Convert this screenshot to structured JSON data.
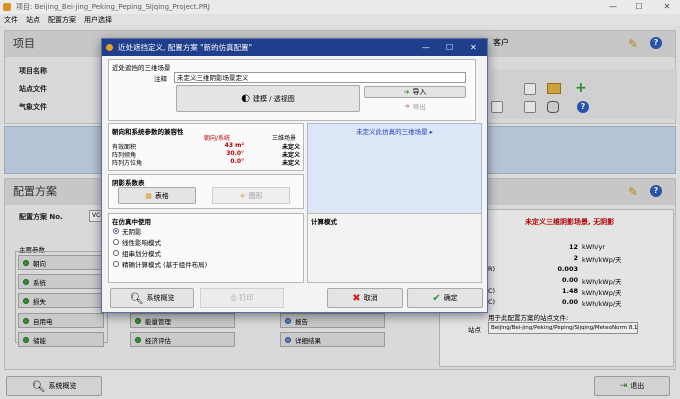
{
  "window": {
    "title": "项目: Beijing_Bei-jing_Peking_Peping_Sijqing_Project.PRJ"
  },
  "menu": [
    "文件",
    "站点",
    "配置方案",
    "用户选择"
  ],
  "project": {
    "header": "项目",
    "client_label": "客户",
    "fields": [
      {
        "label": "项目名称"
      },
      {
        "label": "站点文件"
      },
      {
        "label": "气象文件"
      }
    ]
  },
  "config": {
    "header": "配置方案",
    "variant_label": "配置方案 No.",
    "variant_value": "VC0",
    "main_params_label": "主要参数",
    "side_buttons": [
      "朝向",
      "系统",
      "损失",
      "自用电",
      "储能"
    ],
    "mid_buttons": [
      "能量管理",
      "经济评估"
    ],
    "right_buttons": [
      "报告",
      "详细结果"
    ],
    "result_title": "未定义三维阴影场景, 无阴影",
    "results": [
      {
        "label": "",
        "value": "12",
        "unit": "kWh/yr"
      },
      {
        "label": "",
        "value": "2",
        "unit": "kWh/kWp/天"
      },
      {
        "label": "R)",
        "value": "0.003",
        "unit": ""
      },
      {
        "label": "",
        "value": "0.00",
        "unit": "kWh/kWp/天"
      },
      {
        "label": "C)",
        "value": "1.48",
        "unit": "kWh/kWp/天"
      },
      {
        "label": "C)",
        "value": "0.00",
        "unit": "kWh/kWp/天"
      }
    ],
    "site_note": "用于此配置方案的站点文件:",
    "site_label": "站点",
    "site_value": "Beijing/Bei-jing/Peking/Peping/Sijqing/MeteoNorm 8.1 (1"
  },
  "bottom": {
    "overview": "系统概览",
    "exit": "退出"
  },
  "dialog": {
    "title": "近处遮挡定义, 配置方案 \"新的仿真配置\"",
    "scene_group": "近处遮挡的三维场景",
    "comment_label": "注释",
    "comment_value": "未定义三维阴影场景定义",
    "build_btn": "建模 / 透视图",
    "import_btn": "导入",
    "export_btn": "导出",
    "compat_group": "朝向和系统参数的兼容性",
    "compat_headers": [
      "朝向/系统",
      "三维场景"
    ],
    "compat_rows": [
      {
        "label": "有效面积",
        "value": "43 m²",
        "scene": "未定义"
      },
      {
        "label": "阵列倾角",
        "value": "30.0°",
        "scene": "未定义"
      },
      {
        "label": "阵列方位角",
        "value": "0.0°",
        "scene": "未定义"
      }
    ],
    "undefined_msg": "未定义此仿真的三维场景 ▸",
    "shading_group": "阴影系数表",
    "table_btn": "表格",
    "graph_btn": "图形",
    "sim_group": "在仿真中使用",
    "sim_options": [
      "无阴影",
      "线性影响模式",
      "组串划分模式",
      "精确计算模式 (基于组件布局)"
    ],
    "calc_group": "计算模式",
    "overview_btn": "系统概览",
    "print_btn": "打印",
    "cancel_btn": "取消",
    "ok_btn": "确定"
  },
  "colors": {
    "accent": "#1f3f8c",
    "panel_blue": "#c6d4ea",
    "red": "#c00000"
  }
}
